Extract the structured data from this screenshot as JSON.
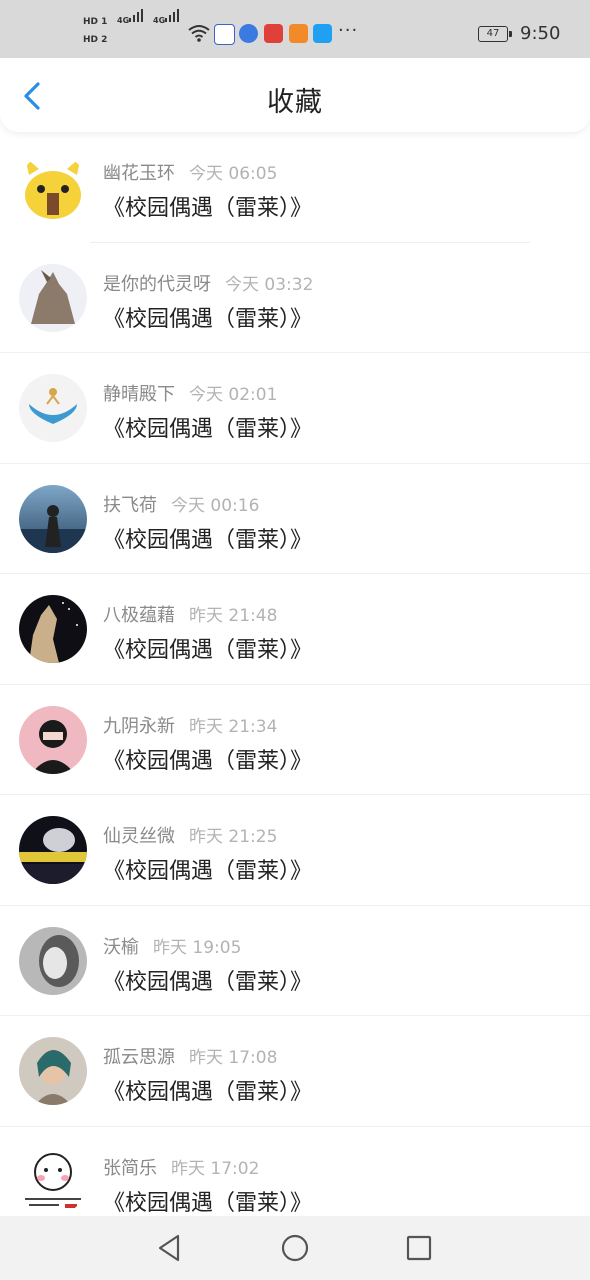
{
  "status_bar": {
    "hd1": "HD 1",
    "hd2": "HD 2",
    "signal1": "4G",
    "signal2": "4G",
    "more": "···",
    "battery": "47",
    "time": "9:50"
  },
  "header": {
    "title": "收藏",
    "back_icon": "chevron-left-icon"
  },
  "items": [
    {
      "user": "幽花玉环",
      "time": "今天 06:05",
      "book": "《校园偶遇（雷莱）》"
    },
    {
      "user": "是你的代灵呀",
      "time": "今天 03:32",
      "book": "《校园偶遇（雷莱）》"
    },
    {
      "user": "静晴殿下",
      "time": "今天 02:01",
      "book": "《校园偶遇（雷莱）》"
    },
    {
      "user": "扶飞荷",
      "time": "今天 00:16",
      "book": "《校园偶遇（雷莱）》"
    },
    {
      "user": "八极蕴藉",
      "time": "昨天 21:48",
      "book": "《校园偶遇（雷莱）》"
    },
    {
      "user": "九阴永新",
      "time": "昨天 21:34",
      "book": "《校园偶遇（雷莱）》"
    },
    {
      "user": "仙灵丝微",
      "time": "昨天 21:25",
      "book": "《校园偶遇（雷莱）》"
    },
    {
      "user": "沃榆",
      "time": "昨天 19:05",
      "book": "《校园偶遇（雷莱）》"
    },
    {
      "user": "孤云思源",
      "time": "昨天 17:08",
      "book": "《校园偶遇（雷莱）》"
    },
    {
      "user": "张简乐",
      "time": "昨天 17:02",
      "book": "《校园偶遇（雷莱）》"
    }
  ],
  "nav_bar": {
    "back": "triangle-back-icon",
    "home": "circle-home-icon",
    "recents": "square-recents-icon"
  },
  "colors": {
    "accent": "#2a8ee6",
    "status_bar_bg": "#d9d9d9",
    "name_text": "#8a8a8a",
    "time_text": "#b3b3b3"
  }
}
